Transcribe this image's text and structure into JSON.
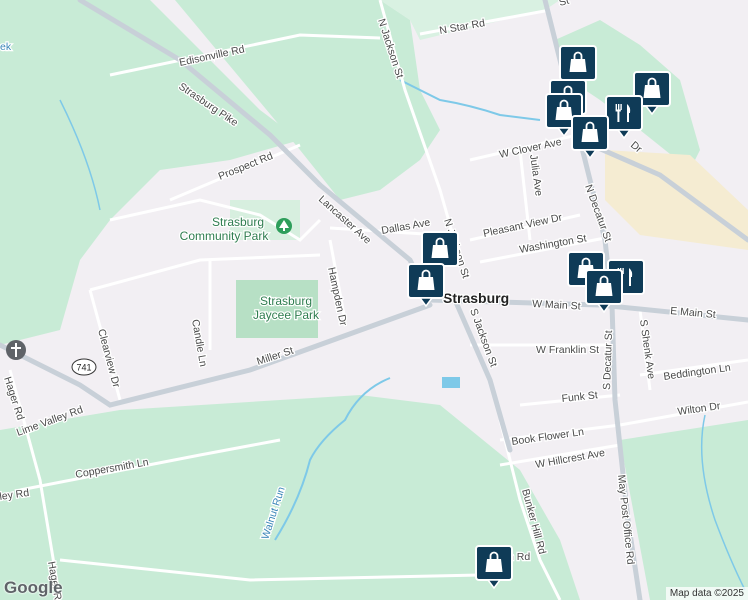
{
  "map": {
    "town": "Strasburg",
    "route_shield": "741",
    "attribution": "Map data ©2025",
    "logo": "Google",
    "colors": {
      "background": "#f2eff3",
      "green_area": "#c8ebd6",
      "park": "#b7e0c5",
      "commercial": "#f5ecd2",
      "water": "#7ec9e8",
      "road_major": "#c8d0d8",
      "road_minor": "#ffffff",
      "pin_fill": "#0f3b57",
      "pin_border": "#ffffff"
    }
  },
  "labels": {
    "streets": {
      "n_star_rd": "N Star Rd",
      "edisonville_rd": "Edisonville Rd",
      "n_jackson_st_top": "N Jackson St",
      "strasburg_pike": "Strasburg Pike",
      "prospect_rd": "Prospect Rd",
      "lancaster_ave": "Lancaster Ave",
      "dallas_ave": "Dallas Ave",
      "w_clover_ave": "W Clover Ave",
      "julia_ave": "Julia Ave",
      "n_decatur_st": "N Decatur St",
      "pleasant_view_dr": "Pleasant View Dr",
      "washington_st": "Washington St",
      "n_jackson_st": "N Jackson St",
      "hampden_dr": "Hampden Dr",
      "w_main_st": "W Main St",
      "e_main_st": "E Main St",
      "miller_st": "Miller St",
      "candle_ln": "Candle Ln",
      "clearview_dr": "Clearview Dr",
      "s_jackson_st": "S Jackson St",
      "w_franklin_st": "W Franklin St",
      "s_decatur_st": "S Decatur St",
      "s_shenk_ave": "S Shenk Ave",
      "beddington_ln": "Beddington Ln",
      "funk_st": "Funk St",
      "lime_valley_rd": "Lime Valley Rd",
      "wilton_dr": "Wilton Dr",
      "book_flower_ln": "Book Flower Ln",
      "w_hillcrest_ave": "W Hillcrest Ave",
      "coppersmith_ln": "Coppersmith Ln",
      "bunker_hill_rd": "Bunker Hill Rd",
      "may_post_office_rd": "May Post Office Rd",
      "walnut_run": "Walnut Run",
      "dr_partial": "Dr",
      "rd_partial_bottom": "n Rd",
      "ley_rd_partial": "ley Rd",
      "hager_rd_partial": "Hager Rd",
      "ek_partial": "ek",
      "st_partial_top": "St"
    },
    "parks": {
      "community_park_line1": "Strasburg",
      "community_park_line2": "Community Park",
      "jaycee_park_line1": "Strasburg",
      "jaycee_park_line2": "Jaycee Park"
    }
  },
  "pins": [
    {
      "name": "shopping-pin-1",
      "icon": "shopping-bag-icon"
    },
    {
      "name": "shopping-pin-2",
      "icon": "shopping-bag-icon"
    },
    {
      "name": "shopping-pin-3",
      "icon": "shopping-bag-icon"
    },
    {
      "name": "restaurant-pin-1",
      "icon": "fork-knife-icon"
    },
    {
      "name": "shopping-pin-4",
      "icon": "shopping-bag-icon"
    },
    {
      "name": "shopping-pin-5",
      "icon": "shopping-bag-icon"
    },
    {
      "name": "shopping-pin-6",
      "icon": "shopping-bag-icon"
    },
    {
      "name": "shopping-pin-7",
      "icon": "shopping-bag-icon"
    },
    {
      "name": "restaurant-pin-2",
      "icon": "fork-knife-icon"
    },
    {
      "name": "shopping-pin-8",
      "icon": "shopping-bag-icon"
    },
    {
      "name": "shopping-pin-9",
      "icon": "shopping-bag-icon"
    },
    {
      "name": "shopping-pin-10",
      "icon": "shopping-bag-icon"
    }
  ]
}
